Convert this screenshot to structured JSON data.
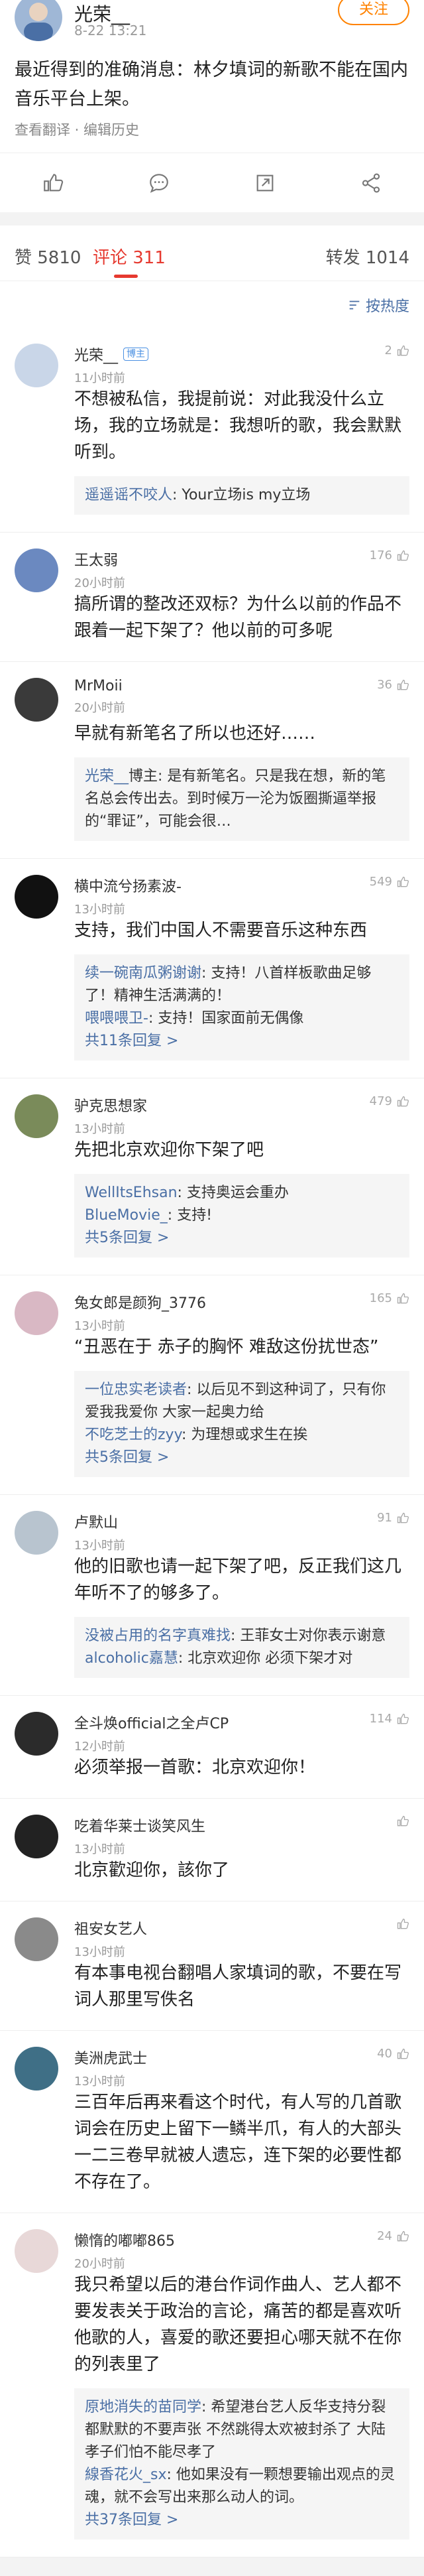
{
  "post": {
    "author": "光荣__",
    "meta": "8-22 13:21",
    "follow_label": "关注",
    "text": "最近得到的准确消息：林夕填词的新歌不能在国内音乐平台上架。",
    "translate_link": "查看翻译 · 编辑历史"
  },
  "tabs": {
    "like": "赞 5810",
    "comment": "评论 311",
    "repost": "转发 1014"
  },
  "sort_label": "按热度",
  "comments": [
    {
      "name": "光荣__",
      "badge": "博主",
      "time": "11小时前",
      "likes": "2",
      "text": "不想被私信，我提前说：对此我没什么立场，我的立场就是：我想听的歌，我会默默听到。",
      "replies": [
        {
          "name": "遥遥谣不咬人",
          "text": ": Your立场is my立场"
        }
      ],
      "more": ""
    },
    {
      "name": "王太弱",
      "badge": "",
      "time": "20小时前",
      "likes": "176",
      "text": "搞所谓的整改还双标？为什么以前的作品不跟着一起下架了？他以前的可多呢",
      "replies": [],
      "more": ""
    },
    {
      "name": "MrMoii",
      "badge": "",
      "time": "20小时前",
      "likes": "36",
      "text": "早就有新笔名了所以也还好……",
      "replies": [
        {
          "name": "光荣__",
          "text": "博主: 是有新笔名。只是我在想，新的笔名总会传出去。到时候万一沦为饭圈撕逼举报的“罪证”，可能会很…"
        }
      ],
      "more": ""
    },
    {
      "name": "横中流兮扬素波-",
      "badge": "",
      "time": "13小时前",
      "likes": "549",
      "text": "支持，我们中国人不需要音乐这种东西",
      "replies": [
        {
          "name": "续一碗南瓜粥谢谢",
          "text": ": 支持！八首样板歌曲足够了！精神生活满满的！"
        },
        {
          "name": "喂喂喂卫-",
          "text": ": 支持！国家面前无偶像"
        }
      ],
      "more": "共11条回复 >"
    },
    {
      "name": "驴克思想家",
      "badge": "",
      "time": "13小时前",
      "likes": "479",
      "text": "先把北京欢迎你下架了吧",
      "replies": [
        {
          "name": "WellItsEhsan",
          "text": ": 支持奥运会重办"
        },
        {
          "name": "BlueMovie_",
          "text": ": 支持!"
        }
      ],
      "more": "共5条回复 >"
    },
    {
      "name": "兔女郎是颜狗_3776",
      "badge": "",
      "time": "13小时前",
      "likes": "165",
      "text": "“丑恶在于 赤子的胸怀 难敌这份扰世态”",
      "replies": [
        {
          "name": "一位忠实老读者",
          "text": ": 以后见不到这种词了，只有你爱我我爱你 大家一起奥力给"
        },
        {
          "name": "不吃芝士的zyy",
          "text": ": 为理想或求生在挨"
        }
      ],
      "more": "共5条回复 >"
    },
    {
      "name": "卢默山",
      "badge": "",
      "time": "13小时前",
      "likes": "91",
      "text": "他的旧歌也请一起下架了吧，反正我们这几年听不了的够多了。",
      "replies": [
        {
          "name": "没被占用的名字真难找",
          "text": ": 王菲女士对你表示谢意"
        },
        {
          "name": "alcoholic嘉慧",
          "text": ": 北京欢迎你 必须下架才对"
        }
      ],
      "more": ""
    },
    {
      "name": "全斗焕official之全卢CP",
      "badge": "",
      "time": "12小时前",
      "likes": "114",
      "text": "必须举报一首歌：北京欢迎你！",
      "replies": [],
      "more": ""
    },
    {
      "name": "吃着华莱士谈笑风生",
      "badge": "",
      "time": "13小时前",
      "likes": "",
      "text": "北京歡迎你，該你了",
      "replies": [],
      "more": ""
    },
    {
      "name": "祖安女艺人",
      "badge": "",
      "time": "13小时前",
      "likes": "",
      "text": "有本事电视台翻唱人家填词的歌，不要在写词人那里写佚名",
      "replies": [],
      "more": ""
    },
    {
      "name": "美洲虎武士",
      "badge": "",
      "time": "13小时前",
      "likes": "40",
      "text": "三百年后再来看这个时代，有人写的几首歌词会在历史上留下一鳞半爪，有人的大部头一二三卷早就被人遗忘，连下架的必要性都不存在了。",
      "replies": [],
      "more": ""
    },
    {
      "name": "懒惰的嘟嘟865",
      "badge": "",
      "time": "20小时前",
      "likes": "24",
      "text": "我只希望以后的港台作词作曲人、艺人都不要发表关于政治的言论，痛苦的都是喜欢听他歌的人，喜爱的歌还要担心哪天就不在你的列表里了",
      "replies": [
        {
          "name": "原地消失的苗同学",
          "text": ": 希望港台艺人反华支持分裂都默默的不要声张 不然跳得太欢被封杀了 大陆孝子们怕不能尽孝了"
        },
        {
          "name": "線香花火_sx",
          "text": ": 他如果没有一颗想要输出观点的灵魂，就不会写出来那么动人的词。"
        }
      ],
      "more": "共37条回复 >"
    }
  ]
}
